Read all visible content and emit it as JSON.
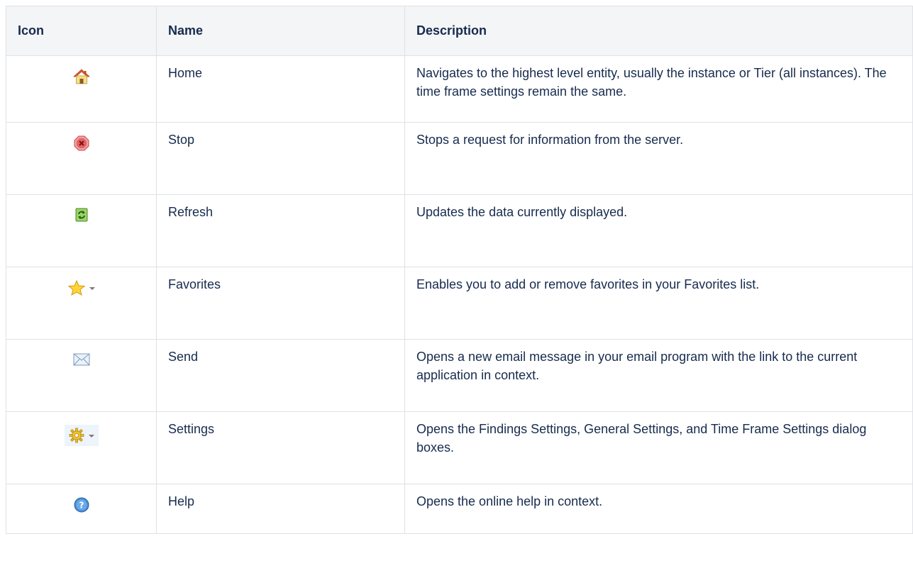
{
  "table": {
    "headers": {
      "icon": "Icon",
      "name": "Name",
      "description": "Description"
    },
    "rows": [
      {
        "icon": "home-icon",
        "name": "Home",
        "description": "Navigates to the highest level entity, usually the instance or Tier (all instances). The time frame settings remain the same."
      },
      {
        "icon": "stop-icon",
        "name": "Stop",
        "description": "Stops a request for information from the server."
      },
      {
        "icon": "refresh-icon",
        "name": "Refresh",
        "description": "Updates the data currently displayed."
      },
      {
        "icon": "star-dropdown-icon",
        "name": "Favorites",
        "description": "Enables you to add or remove favorites in your Favorites list."
      },
      {
        "icon": "envelope-icon",
        "name": "Send",
        "description": "Opens a new email message in your email program with the link to the current application in context."
      },
      {
        "icon": "gear-dropdown-icon",
        "name": "Settings",
        "description": "Opens the Findings Settings, General Settings, and Time Frame Settings dialog boxes."
      },
      {
        "icon": "help-icon",
        "name": "Help",
        "description": "Opens the online help in context."
      }
    ]
  }
}
